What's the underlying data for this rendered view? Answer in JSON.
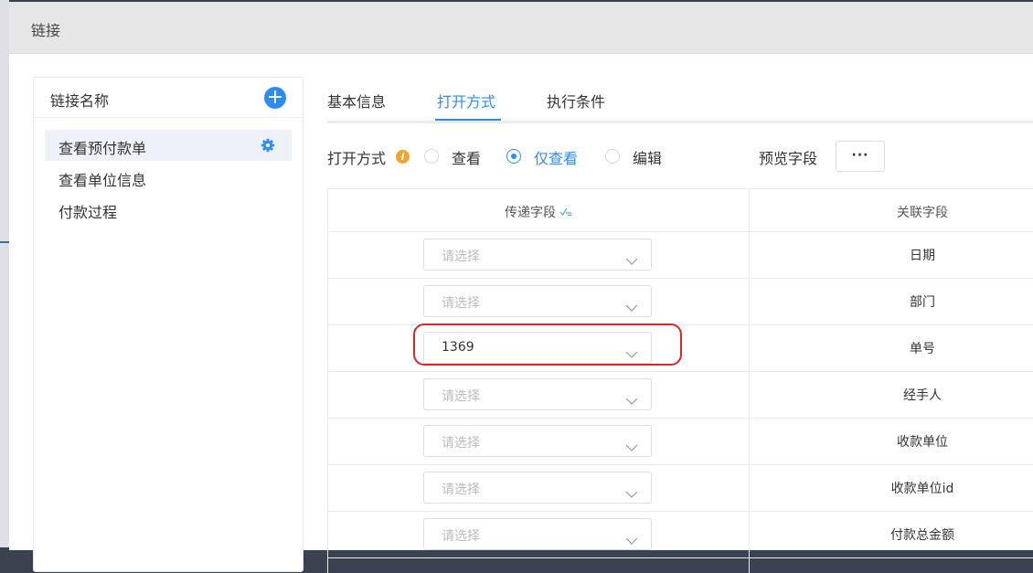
{
  "dialog": {
    "title": "链接"
  },
  "left_panel": {
    "title": "链接名称",
    "add_symbol": "+",
    "items": [
      {
        "label": "查看预付款单",
        "active": true
      },
      {
        "label": "查看单位信息",
        "active": false
      },
      {
        "label": "付款过程",
        "active": false
      }
    ]
  },
  "tabs": [
    {
      "label": "基本信息",
      "active": false
    },
    {
      "label": "打开方式",
      "active": true
    },
    {
      "label": "执行条件",
      "active": false
    }
  ],
  "open_mode": {
    "label": "打开方式",
    "info_symbol": "i",
    "options": [
      {
        "label": "查看",
        "checked": false
      },
      {
        "label": "仅查看",
        "checked": true
      },
      {
        "label": "编辑",
        "checked": false
      }
    ],
    "preview_label": "预览字段",
    "more_label": "···"
  },
  "table": {
    "headers": {
      "pass_field": "传递字段",
      "related_field": "关联字段"
    },
    "rows": [
      {
        "select_value": "请选择",
        "placeholder": true,
        "related": "日期"
      },
      {
        "select_value": "请选择",
        "placeholder": true,
        "related": "部门"
      },
      {
        "select_value": "1369",
        "placeholder": false,
        "related": "单号"
      },
      {
        "select_value": "请选择",
        "placeholder": true,
        "related": "经手人"
      },
      {
        "select_value": "请选择",
        "placeholder": true,
        "related": "收款单位"
      },
      {
        "select_value": "请选择",
        "placeholder": true,
        "related": "收款单位id"
      },
      {
        "select_value": "请选择",
        "placeholder": true,
        "related": "付款总金额"
      }
    ]
  },
  "colors": {
    "accent": "#2d8cf0",
    "highlight": "#d9262a",
    "info": "#f0a531"
  }
}
